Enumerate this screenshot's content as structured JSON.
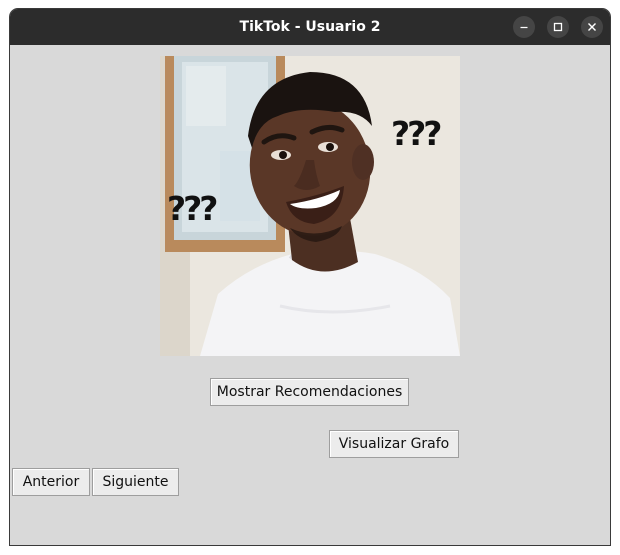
{
  "window": {
    "title": "TikTok - Usuario 2",
    "controls": [
      "minimize-icon",
      "maximize-icon",
      "close-icon"
    ]
  },
  "photo": {
    "overlay_left": "???",
    "overlay_right": "???"
  },
  "buttons": {
    "show_recommendations": "Mostrar Recomendaciones",
    "visualize_graph": "Visualizar Grafo",
    "previous": "Anterior",
    "next": "Siguiente"
  },
  "colors": {
    "titlebar": "#2c2c2c",
    "window_bg": "#d9d9d9",
    "button_bg": "#ececec"
  }
}
